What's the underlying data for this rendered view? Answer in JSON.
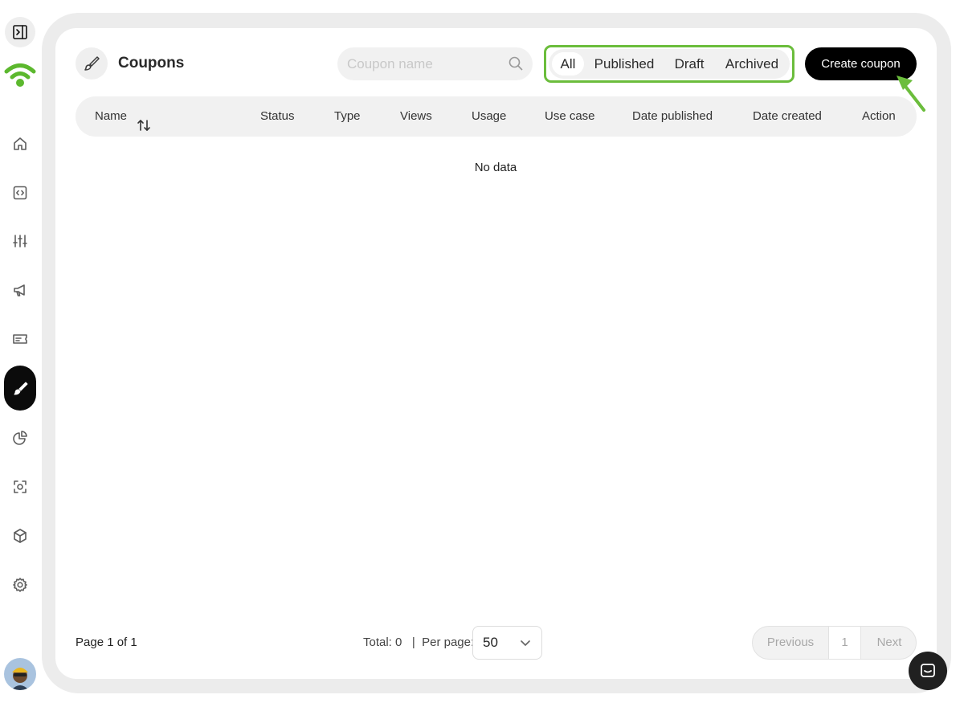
{
  "sidebar": {
    "toggle_icon": "sidebar-toggle-icon",
    "logo_icon": "wifi-logo-icon",
    "items": [
      {
        "icon": "home-icon"
      },
      {
        "icon": "code-icon"
      },
      {
        "icon": "sliders-icon"
      },
      {
        "icon": "megaphone-icon"
      },
      {
        "icon": "ticket-icon"
      },
      {
        "icon": "brush-icon",
        "active": true
      },
      {
        "icon": "pie-chart-icon"
      },
      {
        "icon": "scan-icon"
      },
      {
        "icon": "box-icon"
      },
      {
        "icon": "gear-icon"
      }
    ],
    "avatar_icon": "avatar"
  },
  "header": {
    "title": "Coupons",
    "search_placeholder": "Coupon name",
    "filters": [
      "All",
      "Published",
      "Draft",
      "Archived"
    ],
    "active_filter": "All",
    "create_label": "Create coupon"
  },
  "table": {
    "columns": [
      "Name",
      "Status",
      "Type",
      "Views",
      "Usage",
      "Use case",
      "Date published",
      "Date created",
      "Action"
    ],
    "empty_text": "No data"
  },
  "footer": {
    "page_info": "Page 1 of 1",
    "total_text": "Total: 0   |  Per page:",
    "per_page_value": "50",
    "prev_label": "Previous",
    "current_page": "1",
    "next_label": "Next"
  },
  "colors": {
    "accent_green": "#6bbd3c",
    "primary": "#000000"
  }
}
